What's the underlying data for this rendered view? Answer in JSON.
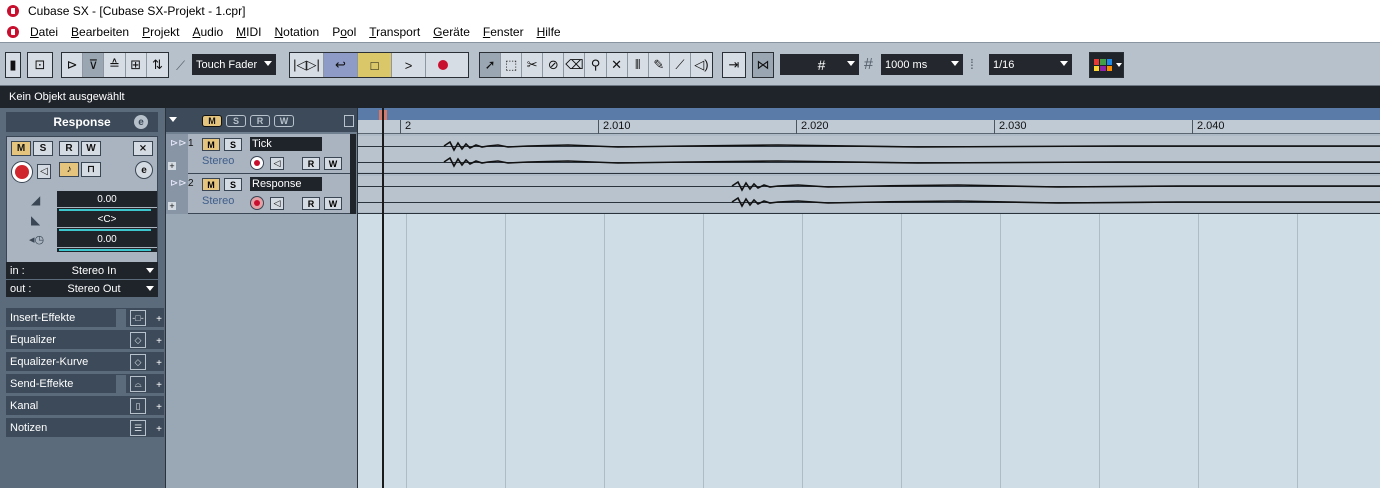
{
  "window": {
    "title": "Cubase SX - [Cubase SX-Projekt - 1.cpr]"
  },
  "menu": [
    {
      "pre": "",
      "u": "D",
      "post": "atei"
    },
    {
      "pre": "",
      "u": "B",
      "post": "earbeiten"
    },
    {
      "pre": "",
      "u": "P",
      "post": "rojekt"
    },
    {
      "pre": "",
      "u": "A",
      "post": "udio"
    },
    {
      "pre": "",
      "u": "M",
      "post": "IDI"
    },
    {
      "pre": "",
      "u": "N",
      "post": "otation"
    },
    {
      "pre": "P",
      "u": "o",
      "post": "ol"
    },
    {
      "pre": "",
      "u": "T",
      "post": "ransport"
    },
    {
      "pre": "",
      "u": "G",
      "post": "eräte"
    },
    {
      "pre": "",
      "u": "F",
      "post": "enster"
    },
    {
      "pre": "",
      "u": "H",
      "post": "ilfe"
    }
  ],
  "toolbar": {
    "automation_mode": "Touch Fader",
    "grid_type_icon": "grid-icon",
    "snap_value": "1000 ms",
    "quantize": "1/16"
  },
  "status": {
    "info_line": "Kein Objekt ausgewählt"
  },
  "inspector": {
    "track_name": "Response",
    "edit_badge": "e",
    "buttons": {
      "mute": "M",
      "solo": "S",
      "read": "R",
      "write": "W"
    },
    "volume": "0.00",
    "pan": "<C>",
    "delay": "0.00",
    "input_label": "in :",
    "input_value": "Stereo In",
    "output_label": "out :",
    "output_value": "Stereo Out",
    "sections": [
      "Insert-Effekte",
      "Equalizer",
      "Equalizer-Kurve",
      "Send-Effekte",
      "Kanal",
      "Notizen"
    ]
  },
  "tracklist": {
    "header_chips": [
      "M",
      "S",
      "R",
      "W"
    ],
    "tracks": [
      {
        "number": "1",
        "name": "Tick",
        "type": "Stereo",
        "mute": "M",
        "solo": "S",
        "read": "R",
        "write": "W"
      },
      {
        "number": "2",
        "name": "Response",
        "type": "Stereo",
        "mute": "M",
        "solo": "S",
        "read": "R",
        "write": "W"
      }
    ]
  },
  "ruler": {
    "labels": [
      "2",
      "2.010",
      "2.020",
      "2.030",
      "2.040"
    ]
  },
  "colors": {
    "accent_record": "#d0262e",
    "mute_yellow": "#e5c57d",
    "arrange_bg": "#cfdee6",
    "inspector_bg": "#5b6b7c"
  }
}
